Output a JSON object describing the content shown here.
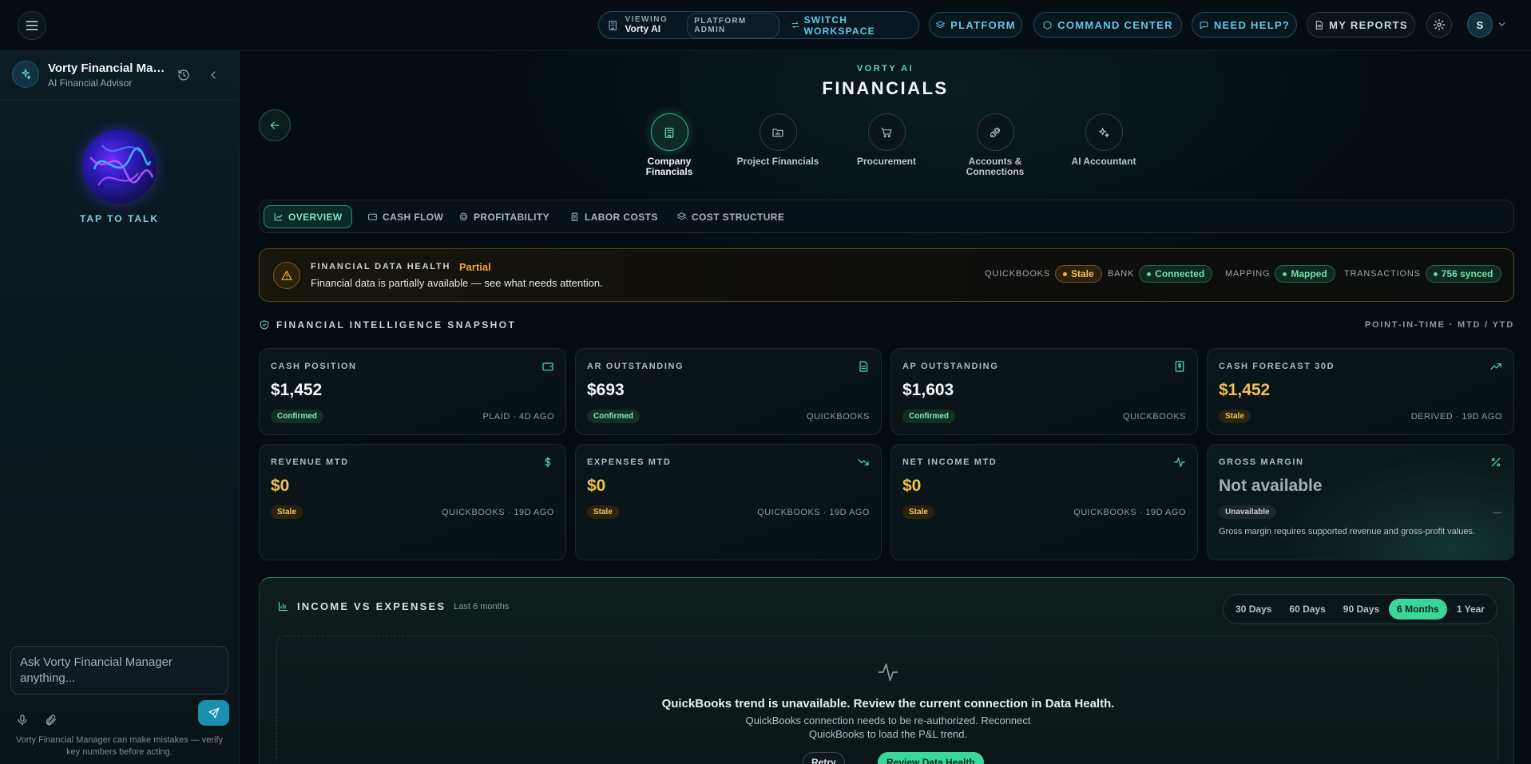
{
  "topbar": {
    "viewing_label": "VIEWING",
    "viewing_value": "Vorty AI",
    "role_badge": "PLATFORM ADMIN",
    "switch_workspace": "SWITCH WORKSPACE",
    "platform": "PLATFORM",
    "command_center": "COMMAND CENTER",
    "need_help": "NEED HELP?",
    "my_reports": "MY REPORTS",
    "avatar_initial": "S"
  },
  "sidebar": {
    "title": "Vorty Financial Manager",
    "subtitle": "AI Financial Advisor",
    "tap_to_talk": "TAP TO TALK",
    "input_placeholder": "Ask Vorty Financial Manager anything...",
    "disclaimer": "Vorty Financial Manager can make mistakes — verify key numbers before acting."
  },
  "header": {
    "brand": "VORTY AI",
    "title": "FINANCIALS"
  },
  "section_nav": [
    {
      "label": "Company Financials",
      "icon": "building-icon",
      "active": true
    },
    {
      "label": "Project Financials",
      "icon": "folder-chart-icon",
      "active": false
    },
    {
      "label": "Procurement",
      "icon": "cart-icon",
      "active": false
    },
    {
      "label": "Accounts & Connections",
      "icon": "plug-icon",
      "active": false
    },
    {
      "label": "AI Accountant",
      "icon": "sparkles-icon",
      "active": false
    }
  ],
  "tabs": [
    {
      "label": "OVERVIEW",
      "icon": "line-chart-icon",
      "active": true
    },
    {
      "label": "CASH FLOW",
      "icon": "wallet-icon",
      "active": false
    },
    {
      "label": "PROFITABILITY",
      "icon": "target-icon",
      "active": false
    },
    {
      "label": "LABOR COSTS",
      "icon": "clipboard-icon",
      "active": false
    },
    {
      "label": "COST STRUCTURE",
      "icon": "layers-icon",
      "active": false
    }
  ],
  "health": {
    "title": "FINANCIAL DATA HEALTH",
    "status": "Partial",
    "message": "Financial data is partially available — see what needs attention.",
    "stats": [
      {
        "label": "QUICKBOOKS",
        "value": "Stale",
        "tone": "amber"
      },
      {
        "label": "BANK",
        "value": "Connected",
        "tone": "green"
      },
      {
        "label": "MAPPING",
        "value": "Mapped",
        "tone": "green"
      },
      {
        "label": "TRANSACTIONS",
        "value": "756 synced",
        "tone": "green"
      }
    ]
  },
  "snapshot": {
    "title": "FINANCIAL INTELLIGENCE SNAPSHOT",
    "period": "POINT-IN-TIME · MTD / YTD"
  },
  "cards": [
    {
      "label": "CASH POSITION",
      "value": "$1,452",
      "badge": "Confirmed",
      "source": "PLAID · 4D AGO",
      "icon": "wallet-icon"
    },
    {
      "label": "AR OUTSTANDING",
      "value": "$693",
      "badge": "Confirmed",
      "source": "QUICKBOOKS",
      "icon": "document-icon"
    },
    {
      "label": "AP OUTSTANDING",
      "value": "$1,603",
      "badge": "Confirmed",
      "source": "QUICKBOOKS",
      "icon": "receipt-dollar-icon"
    },
    {
      "label": "CASH FORECAST 30D",
      "value": "$1,452",
      "badge": "Stale",
      "source": "DERIVED · 19D AGO",
      "icon": "trend-up-icon"
    },
    {
      "label": "REVENUE MTD",
      "value": "$0",
      "badge": "Stale",
      "source": "QUICKBOOKS · 19D AGO",
      "icon": "dollar-icon"
    },
    {
      "label": "EXPENSES MTD",
      "value": "$0",
      "badge": "Stale",
      "source": "QUICKBOOKS · 19D AGO",
      "icon": "trend-down-icon"
    },
    {
      "label": "NET INCOME MTD",
      "value": "$0",
      "badge": "Stale",
      "source": "QUICKBOOKS · 19D AGO",
      "icon": "pulse-icon"
    },
    {
      "label": "GROSS MARGIN",
      "value": "Not available",
      "badge": "Unavailable",
      "source": "—",
      "icon": "percent-icon",
      "note": "Gross margin requires supported revenue and gross-profit values."
    }
  ],
  "income_panel": {
    "title": "INCOME VS EXPENSES",
    "subtitle": "Last 6 months",
    "ranges": [
      "30 Days",
      "60 Days",
      "90 Days",
      "6 Months",
      "1 Year"
    ],
    "active_range": "6 Months",
    "empty_title": "QuickBooks trend is unavailable. Review the current connection in Data Health.",
    "empty_message": "QuickBooks connection needs to be re-authorized. Reconnect QuickBooks to load the P&L trend.",
    "retry": "Retry",
    "review": "Review Data Health"
  },
  "colors": {
    "accent_green": "#3ad79b",
    "accent_cyan": "#62c6e8",
    "warning_amber": "#f0a929"
  }
}
